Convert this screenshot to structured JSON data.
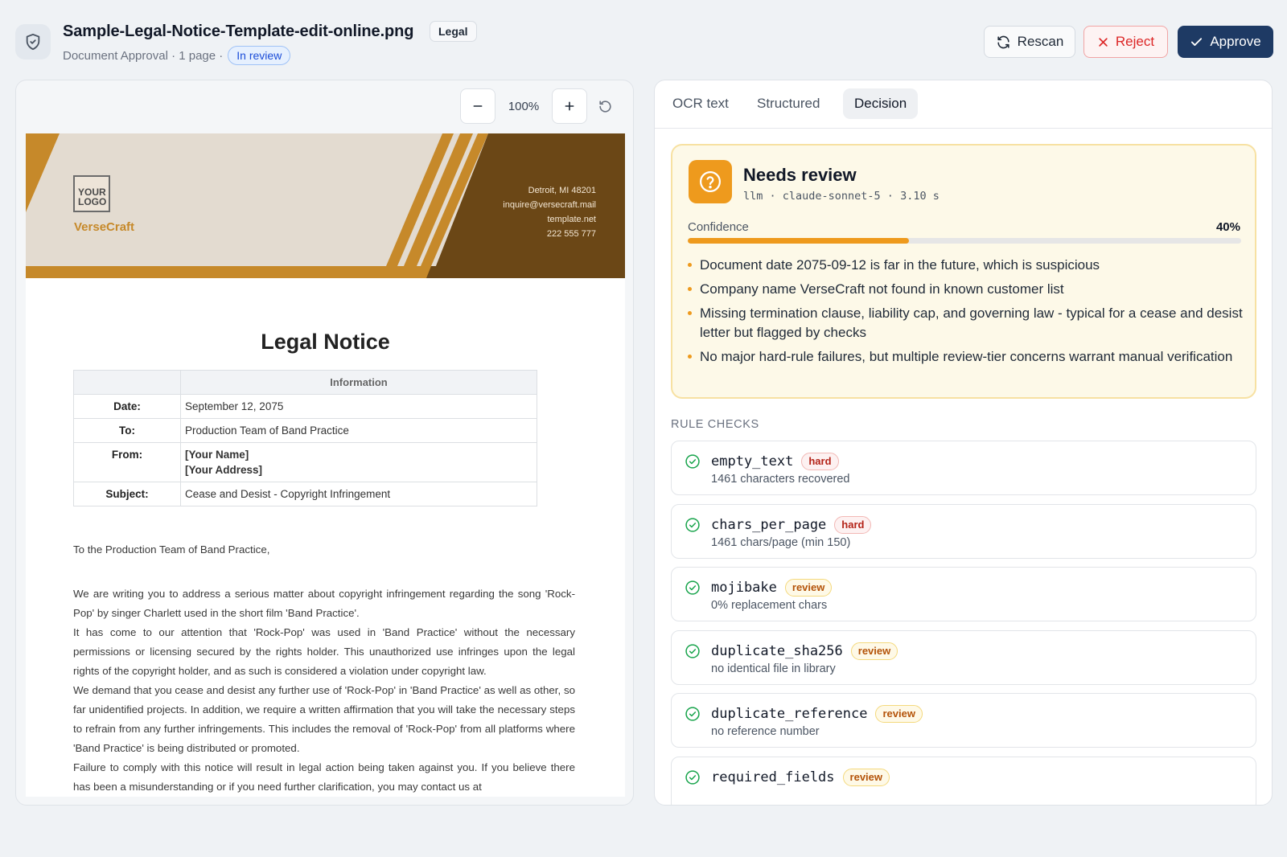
{
  "header": {
    "filename": "Sample-Legal-Notice-Template-edit-online.png",
    "category_tag": "Legal",
    "subtitle": "Document Approval · 1 page ·",
    "status": "In review",
    "actions": {
      "rescan": "Rescan",
      "reject": "Reject",
      "approve": "Approve"
    }
  },
  "viewer": {
    "zoom": "100%",
    "document": {
      "logo_line1": "YOUR",
      "logo_line2": "LOGO",
      "brand": "VerseCraft",
      "contact": [
        "Detroit, MI 48201",
        "inquire@versecraft.mail",
        "template.net",
        "222 555 777"
      ],
      "title": "Legal Notice",
      "table_header": "Information",
      "rows": [
        {
          "label": "Date:",
          "value": "September 12, 2075"
        },
        {
          "label": "To:",
          "value": "Production Team of Band Practice"
        },
        {
          "label": "From:",
          "value": "[Your Name]",
          "value2": "[Your Address]"
        },
        {
          "label": "Subject:",
          "value": "Cease and Desist - Copyright Infringement"
        }
      ],
      "greeting": "To the Production Team of Band Practice,",
      "paragraphs": [
        "We are writing you to address a serious matter about copyright infringement regarding the song 'Rock-Pop' by singer Charlett used in the short film 'Band Practice'.",
        "It has come to our attention that 'Rock-Pop' was used in 'Band Practice' without the necessary permissions or licensing secured by the rights holder. This unauthorized use infringes upon the legal rights of the copyright holder, and as such is considered a violation under copyright law.",
        "We demand that you cease and desist any further use of 'Rock-Pop' in 'Band Practice' as well as other, so far unidentified projects. In addition, we require a written affirmation that you will take the necessary steps to refrain from any further infringements. This includes the removal of 'Rock-Pop' from all platforms where 'Band Practice' is being distributed or promoted.",
        "Failure to comply with this notice will result in legal action being taken against you. If you believe there has been a misunderstanding or if you need further clarification, you may contact us at"
      ]
    }
  },
  "panel": {
    "tabs": [
      "OCR text",
      "Structured",
      "Decision"
    ],
    "active_tab": "Decision",
    "decision": {
      "title": "Needs review",
      "meta": "llm · claude-sonnet-5 · 3.10 s",
      "confidence_label": "Confidence",
      "confidence_text": "40%",
      "confidence_value": 0.4,
      "reasons": [
        "Document date 2075-09-12 is far in the future, which is suspicious",
        "Company name VerseCraft not found in known customer list",
        "Missing termination clause, liability cap, and governing law - typical for a cease and desist letter but flagged by checks",
        "No major hard-rule failures, but multiple review-tier concerns warrant manual verification"
      ]
    },
    "rules_heading": "RULE CHECKS",
    "rules": [
      {
        "name": "empty_text",
        "tier": "hard",
        "desc": "1461 characters recovered"
      },
      {
        "name": "chars_per_page",
        "tier": "hard",
        "desc": "1461 chars/page (min 150)"
      },
      {
        "name": "mojibake",
        "tier": "review",
        "desc": "0% replacement chars"
      },
      {
        "name": "duplicate_sha256",
        "tier": "review",
        "desc": "no identical file in library"
      },
      {
        "name": "duplicate_reference",
        "tier": "review",
        "desc": "no reference number"
      },
      {
        "name": "required_fields",
        "tier": "review",
        "desc": ""
      }
    ]
  },
  "colors": {
    "accent": "#1e3a64",
    "warning": "#ee9a1d",
    "danger": "#dc2626",
    "success": "#16a34a",
    "banner_dark": "#6b4716",
    "banner_gold": "#c6892a"
  },
  "icons": [
    "shield-check-icon",
    "refresh-icon",
    "close-icon",
    "check-icon",
    "minus-icon",
    "plus-icon",
    "rotate-icon",
    "question-circle-icon",
    "check-circle-icon"
  ]
}
